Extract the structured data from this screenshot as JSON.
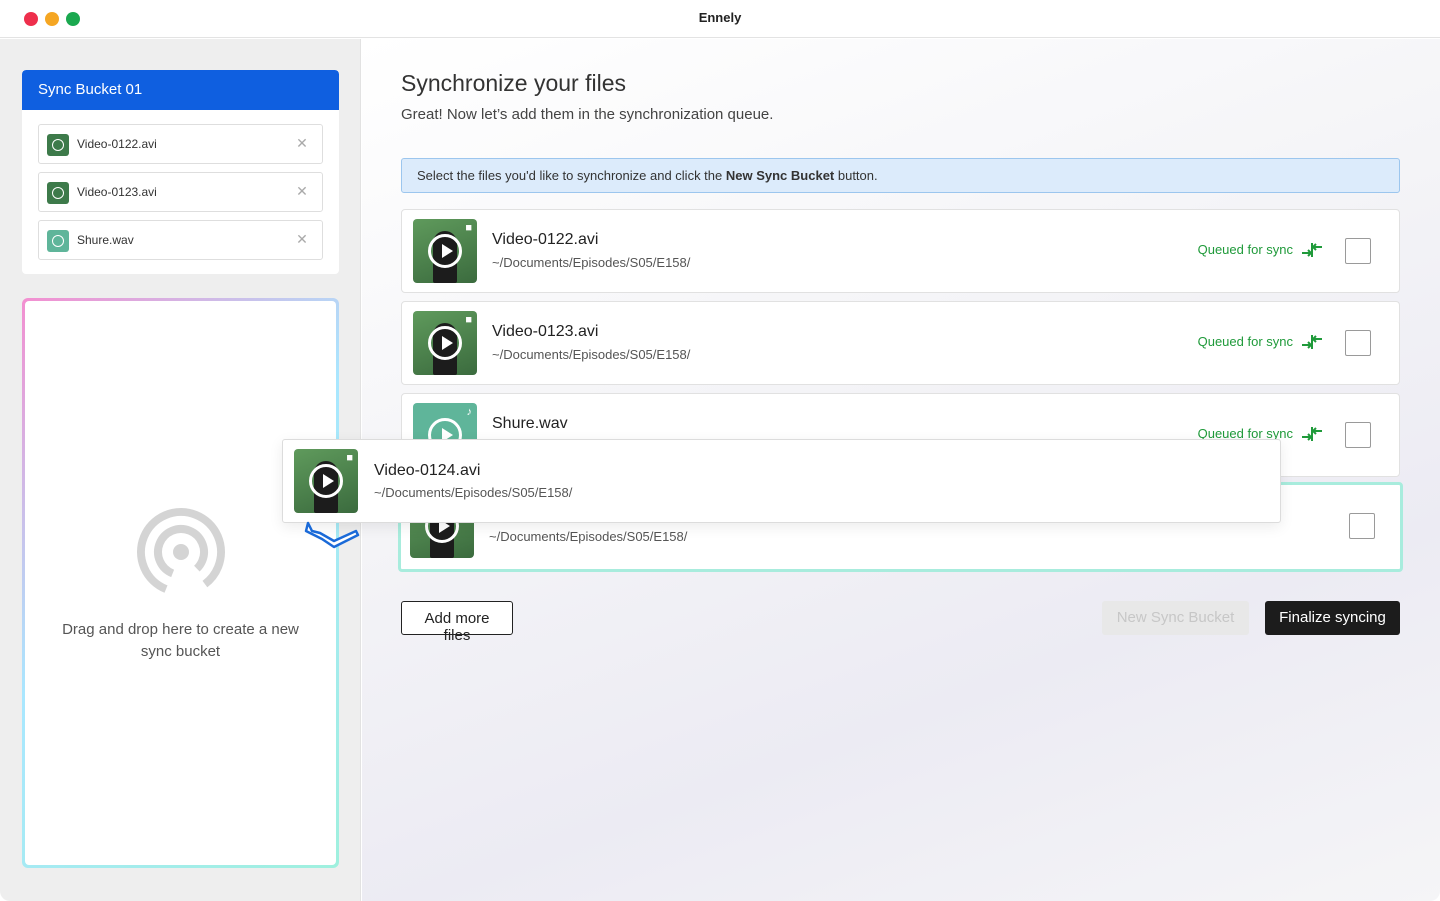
{
  "window": {
    "title": "Ennely"
  },
  "sidebar": {
    "bucket": {
      "title": "Sync Bucket 01",
      "items": [
        {
          "name": "Video-0122.avi",
          "type": "video"
        },
        {
          "name": "Video-0123.avi",
          "type": "video"
        },
        {
          "name": "Shure.wav",
          "type": "audio"
        }
      ],
      "remove_glyph": "✕"
    },
    "dropzone": {
      "text": "Drag and drop here to create a new sync bucket"
    }
  },
  "main": {
    "title": "Synchronize your files",
    "subtitle": "Great! Now let’s add them in the synchronization queue.",
    "banner": {
      "prefix": "Select the files you'd like to synchronize and click the ",
      "emphasis": "New Sync Bucket",
      "suffix": " button."
    },
    "files": [
      {
        "name": "Video-0122.avi",
        "path": "~/Documents/Episodes/S05/E158/",
        "status": "Queued for sync",
        "type": "video",
        "checked": false
      },
      {
        "name": "Video-0123.avi",
        "path": "~/Documents/Episodes/S05/E158/",
        "status": "Queued for sync",
        "type": "video",
        "checked": false
      },
      {
        "name": "Shure.wav",
        "path": "",
        "status": "Queued for sync",
        "type": "audio",
        "checked": false
      },
      {
        "name": "",
        "path": "~/Documents/Episodes/S05/E158/",
        "status": "",
        "type": "video",
        "checked": false
      }
    ],
    "dragging": {
      "name": "Video-0124.avi",
      "path": "~/Documents/Episodes/S05/E158/",
      "type": "video"
    },
    "buttons": {
      "add_more": "Add more files",
      "new_bucket": "New Sync Bucket",
      "finalize": "Finalize syncing"
    }
  },
  "colors": {
    "accent": "#0f5fe0",
    "status_green": "#1f9a3a",
    "banner_bg": "#dcebfb",
    "primary_button": "#1c1c1c"
  }
}
